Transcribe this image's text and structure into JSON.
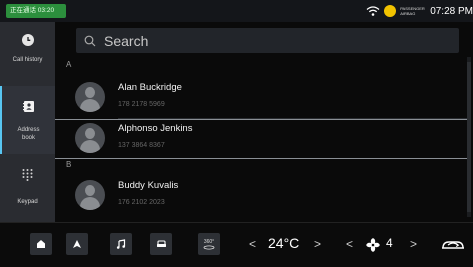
{
  "status_bar": {
    "call_status": "正在通话 03:20",
    "weather_line1": "PASSENGER",
    "weather_line2": "AIRBAG",
    "time": "07:28 PM"
  },
  "sidebar": {
    "items": [
      {
        "label": "Call history",
        "icon": "clock-icon",
        "active": false
      },
      {
        "label": "Address book",
        "icon": "contacts-book-icon",
        "active": true
      },
      {
        "label": "Keypad",
        "icon": "keypad-icon",
        "active": false
      }
    ]
  },
  "search": {
    "placeholder": "Search"
  },
  "contacts": {
    "sections": [
      {
        "letter": "A",
        "entries": [
          {
            "name": "Alan Buckridge",
            "phone": "178 2178 5969"
          },
          {
            "name": "Alphonso Jenkins",
            "phone": "137 3864 8367"
          }
        ]
      },
      {
        "letter": "B",
        "entries": [
          {
            "name": "Buddy Kuvalis",
            "phone": "176 2102 2023"
          }
        ]
      }
    ]
  },
  "bottom_bar": {
    "buttons": [
      "home-icon",
      "navigation-icon",
      "music-icon",
      "car-icon",
      "view-360-icon"
    ],
    "view360_label": "360°",
    "temperature": "24°C",
    "fan_level": "4",
    "prev_symbol": "<",
    "next_symbol": ">"
  },
  "colors": {
    "accent": "#58c6f2",
    "call_green": "#2c8f3d",
    "background": "#0a0a0a"
  }
}
